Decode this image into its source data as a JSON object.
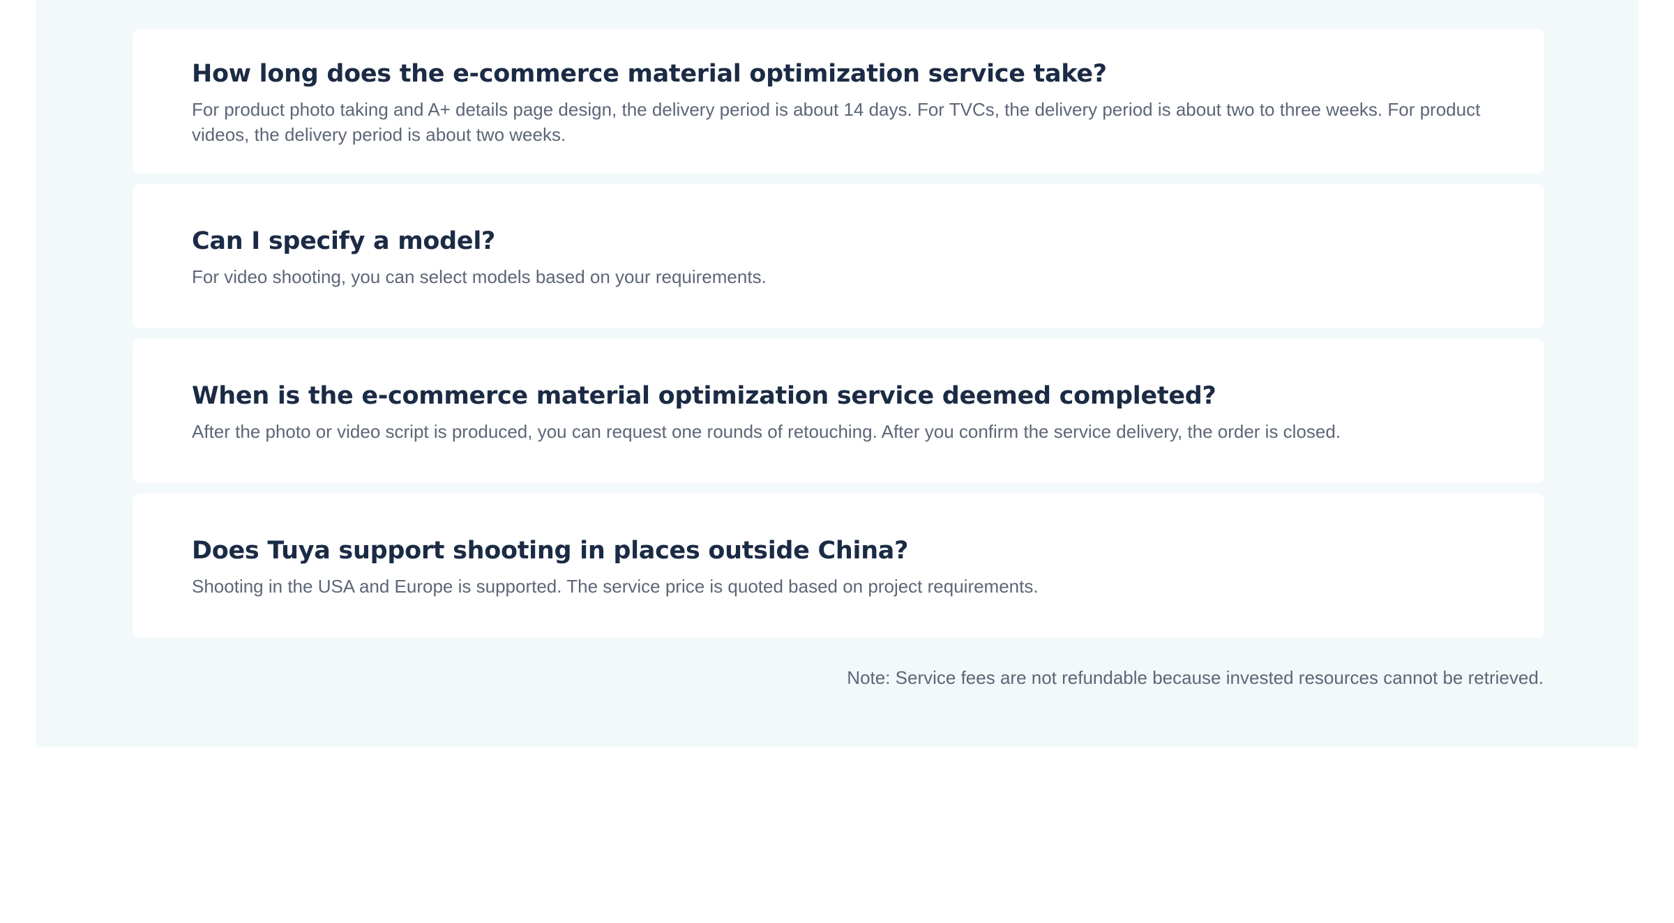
{
  "faq": {
    "items": [
      {
        "question": "How long does the e-commerce material optimization service take?",
        "answer": "For product photo taking and A+ details page design, the delivery period is about 14 days. For TVCs, the delivery period is about two to three weeks. For product videos, the delivery period is about two weeks."
      },
      {
        "question": "Can I specify a model?",
        "answer": "For video shooting, you can select models based on your requirements."
      },
      {
        "question": "When is the e-commerce material optimization service deemed completed?",
        "answer": "After the photo or video script is produced, you can request one rounds of retouching. After you confirm the service delivery, the order is closed."
      },
      {
        "question": "Does Tuya support shooting in places outside China?",
        "answer": "Shooting in the USA and Europe is supported. The service price is quoted based on project requirements."
      }
    ],
    "note": "Note: Service fees are not refundable because invested resources cannot be retrieved."
  },
  "colors": {
    "section_background": "#f3f9fa",
    "card_background": "#ffffff",
    "question_text": "#1b2b45",
    "answer_text": "#5d6677"
  }
}
